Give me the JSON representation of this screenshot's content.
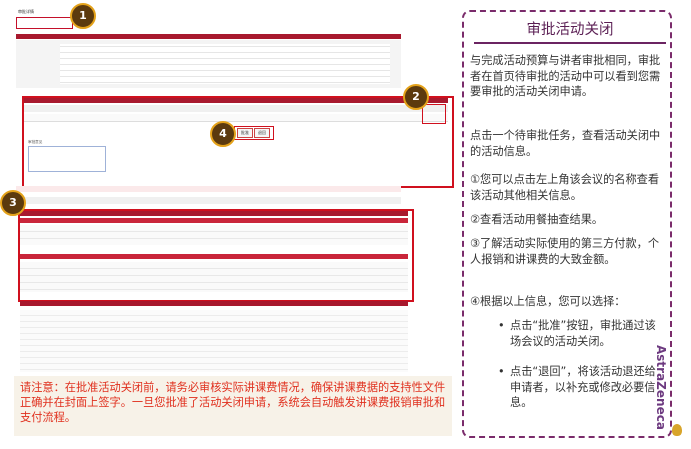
{
  "screenshot": {
    "top_link": "审批详情",
    "badges": [
      "1",
      "2",
      "3",
      "4"
    ],
    "buttons": {
      "approve": "批准",
      "reject": "退回"
    },
    "section_labels": {
      "approval_comment": "审批意见"
    }
  },
  "note": "请注意：在批准活动关闭前，请务必审核实际讲课费情况，确保讲课费据的支持性文件正确并在封面上签字。一旦您批准了活动关闭申请，系统会自动触发讲课费报销审批和支付流程。",
  "panel": {
    "title": "审批活动关闭",
    "intro": "与完成活动预算与讲者审批相同，审批者在首页待审批的活动中可以看到您需要审批的活动关闭申请。",
    "step1": "点击一个待审批任务，查看活动关闭中的活动信息。",
    "item1": "①您可以点击左上角该会议的名称查看 该活动其他相关信息。",
    "item2": "②查看活动用餐抽查结果。",
    "item3": "③了解活动实际使用的第三方付款，个人报销和讲课费的大致金额。",
    "item4": "④根据以上信息，您可以选择：",
    "bullet1": "点击“批准”按钮，审批通过该场会议的活动关闭。",
    "bullet2": "点击“退回”，将该活动退还给申请者，以补充或修改必要信息。"
  },
  "brand": "AstraZeneca"
}
